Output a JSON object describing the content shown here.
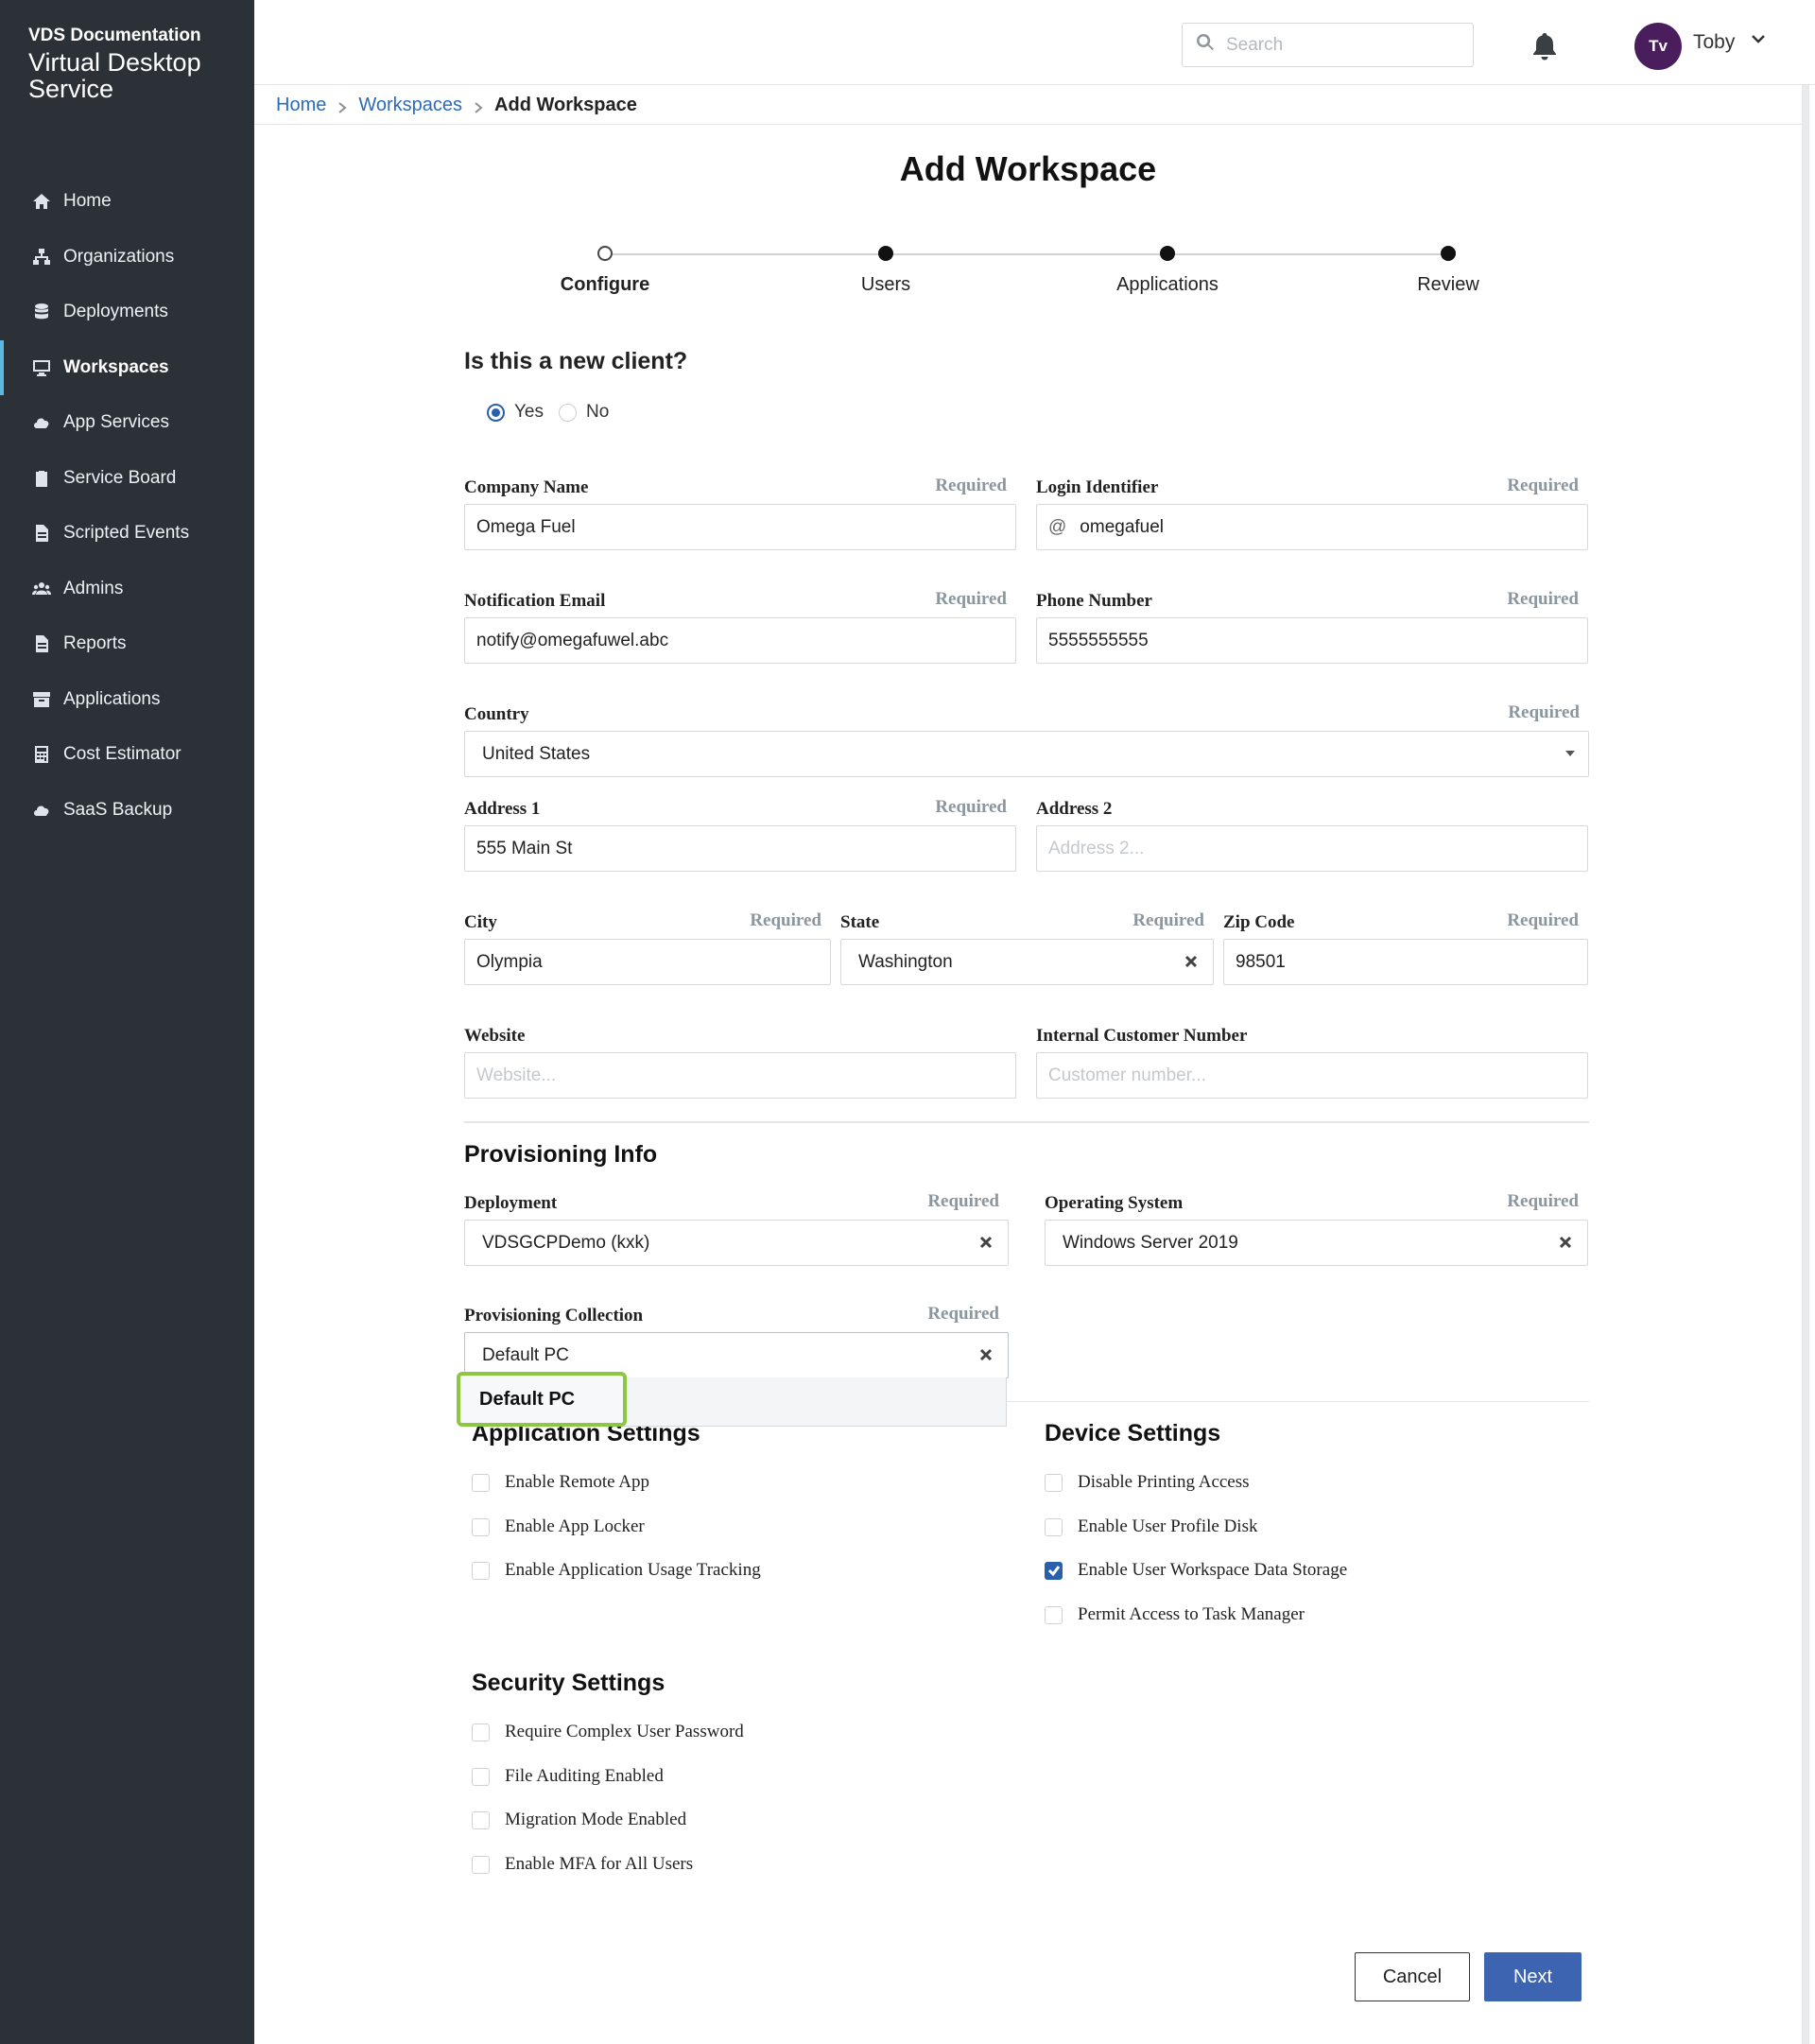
{
  "brand": {
    "org": "VDS Documentation",
    "product": "Virtual Desktop Service"
  },
  "nav": [
    {
      "label": "Home",
      "icon": "home-icon",
      "active": false
    },
    {
      "label": "Organizations",
      "icon": "org-icon",
      "active": false
    },
    {
      "label": "Deployments",
      "icon": "database-icon",
      "active": false
    },
    {
      "label": "Workspaces",
      "icon": "monitor-icon",
      "active": true
    },
    {
      "label": "App Services",
      "icon": "cloud-icon",
      "active": false
    },
    {
      "label": "Service Board",
      "icon": "clipboard-icon",
      "active": false
    },
    {
      "label": "Scripted Events",
      "icon": "script-file-icon",
      "active": false
    },
    {
      "label": "Admins",
      "icon": "users-icon",
      "active": false
    },
    {
      "label": "Reports",
      "icon": "report-file-icon",
      "active": false
    },
    {
      "label": "Applications",
      "icon": "archive-icon",
      "active": false
    },
    {
      "label": "Cost Estimator",
      "icon": "calculator-icon",
      "active": false
    },
    {
      "label": "SaaS Backup",
      "icon": "cloud-backup-icon",
      "active": false
    }
  ],
  "header": {
    "search_placeholder": "Search",
    "avatar_initials": "Tv",
    "user_name": "Toby"
  },
  "breadcrumb": {
    "home": "Home",
    "workspaces": "Workspaces",
    "current": "Add Workspace"
  },
  "page_title": "Add Workspace",
  "stepper": {
    "steps": [
      {
        "label": "Configure",
        "current": true
      },
      {
        "label": "Users",
        "current": false
      },
      {
        "label": "Applications",
        "current": false
      },
      {
        "label": "Review",
        "current": false
      }
    ]
  },
  "form": {
    "new_client_question": "Is this a new client?",
    "new_client_options": [
      "Yes",
      "No"
    ],
    "new_client_selected": "Yes",
    "required_label": "Required",
    "company_name": {
      "label": "Company Name",
      "value": "Omega Fuel"
    },
    "login_identifier": {
      "label": "Login Identifier",
      "prefix": "@",
      "value": "omegafuel"
    },
    "notification_email": {
      "label": "Notification Email",
      "value": "notify@omegafuwel.abc"
    },
    "phone_number": {
      "label": "Phone Number",
      "value": "5555555555"
    },
    "country": {
      "label": "Country",
      "value": "United States"
    },
    "address1": {
      "label": "Address 1",
      "value": "555 Main St"
    },
    "address2": {
      "label": "Address 2",
      "placeholder": "Address 2..."
    },
    "city": {
      "label": "City",
      "value": "Olympia"
    },
    "state": {
      "label": "State",
      "value": "Washington"
    },
    "zip": {
      "label": "Zip Code",
      "value": "98501"
    },
    "website": {
      "label": "Website",
      "placeholder": "Website..."
    },
    "customer_number": {
      "label": "Internal Customer Number",
      "placeholder": "Customer number..."
    }
  },
  "provisioning": {
    "title": "Provisioning Info",
    "deployment": {
      "label": "Deployment",
      "value": "VDSGCPDemo (kxk)"
    },
    "os": {
      "label": "Operating System",
      "value": "Windows Server 2019"
    },
    "collection": {
      "label": "Provisioning Collection",
      "value": "Default PC",
      "options": [
        "Default PC"
      ]
    }
  },
  "application_settings": {
    "title": "Application Settings",
    "items": [
      {
        "label": "Enable Remote App",
        "checked": false
      },
      {
        "label": "Enable App Locker",
        "checked": false
      },
      {
        "label": "Enable Application Usage Tracking",
        "checked": false
      }
    ]
  },
  "device_settings": {
    "title": "Device Settings",
    "items": [
      {
        "label": "Disable Printing Access",
        "checked": false
      },
      {
        "label": "Enable User Profile Disk",
        "checked": false
      },
      {
        "label": "Enable User Workspace Data Storage",
        "checked": true
      },
      {
        "label": "Permit Access to Task Manager",
        "checked": false
      }
    ]
  },
  "security_settings": {
    "title": "Security Settings",
    "items": [
      {
        "label": "Require Complex User Password",
        "checked": false
      },
      {
        "label": "File Auditing Enabled",
        "checked": false
      },
      {
        "label": "Migration Mode Enabled",
        "checked": false
      },
      {
        "label": "Enable MFA for All Users",
        "checked": false
      }
    ]
  },
  "actions": {
    "cancel": "Cancel",
    "next": "Next"
  },
  "colors": {
    "sidebar_bg": "#2b3136",
    "accent": "#3d64b0",
    "highlight": "#8dc63f",
    "avatar_bg": "#4a1d5c"
  }
}
